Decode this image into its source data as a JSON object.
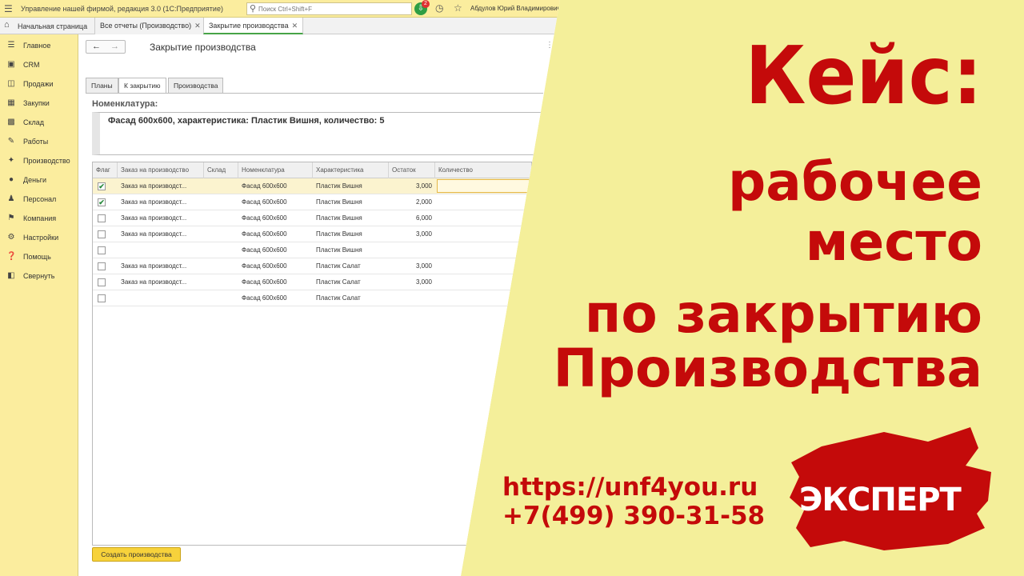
{
  "app": {
    "title": "Управление нашей фирмой, редакция 3.0  (1С:Предприятие)",
    "search_placeholder": "Поиск Ctrl+Shift+F",
    "notification_count": "2",
    "user": "Абдулов Юрий Владимирович"
  },
  "tabs": {
    "home": "Начальная страница",
    "open": [
      {
        "label": "Все отчеты (Производство)"
      },
      {
        "label": "Закрытие производства"
      }
    ]
  },
  "sidebar": {
    "items": [
      {
        "label": "Главное",
        "icon": "list-icon"
      },
      {
        "label": "CRM",
        "icon": "crm-icon"
      },
      {
        "label": "Продажи",
        "icon": "cart-icon"
      },
      {
        "label": "Закупки",
        "icon": "purchase-icon"
      },
      {
        "label": "Склад",
        "icon": "warehouse-icon"
      },
      {
        "label": "Работы",
        "icon": "works-icon"
      },
      {
        "label": "Производство",
        "icon": "tools-icon"
      },
      {
        "label": "Деньги",
        "icon": "money-icon"
      },
      {
        "label": "Персонал",
        "icon": "people-icon"
      },
      {
        "label": "Компания",
        "icon": "flag-icon"
      },
      {
        "label": "Настройки",
        "icon": "gear-icon"
      },
      {
        "label": "Помощь",
        "icon": "help-icon"
      },
      {
        "label": "Свернуть",
        "icon": "collapse-icon"
      }
    ]
  },
  "form": {
    "title": "Закрытие производства",
    "tabs": [
      {
        "label": "Планы"
      },
      {
        "label": "К закрытию"
      },
      {
        "label": "Производства"
      }
    ],
    "nomenclature_label": "Номенклатура:",
    "nomenclature_value": "Фасад 600х600, характеристика: Пластик Вишня, количество: 5",
    "columns": [
      "Флаг",
      "Заказ на производство",
      "Склад",
      "Номенклатура",
      "Характеристика",
      "Остаток",
      "Количество"
    ],
    "rows": [
      {
        "flag": true,
        "order": "Заказ на производст...",
        "warehouse": "",
        "item": "Фасад 600х600",
        "characteristic": "Пластик Вишня",
        "balance": "3,000",
        "quantity": ""
      },
      {
        "flag": true,
        "order": "Заказ на производст...",
        "warehouse": "",
        "item": "Фасад 600х600",
        "characteristic": "Пластик Вишня",
        "balance": "2,000",
        "quantity": ""
      },
      {
        "flag": false,
        "order": "Заказ на производст...",
        "warehouse": "",
        "item": "Фасад 600х600",
        "characteristic": "Пластик Вишня",
        "balance": "6,000",
        "quantity": ""
      },
      {
        "flag": false,
        "order": "Заказ на производст...",
        "warehouse": "",
        "item": "Фасад 600х600",
        "characteristic": "Пластик Вишня",
        "balance": "3,000",
        "quantity": ""
      },
      {
        "flag": false,
        "order": "",
        "warehouse": "",
        "item": "Фасад 600х600",
        "characteristic": "Пластик Вишня",
        "balance": "",
        "quantity": ""
      },
      {
        "flag": false,
        "order": "Заказ на производст...",
        "warehouse": "",
        "item": "Фасад 600х600",
        "characteristic": "Пластик Салат",
        "balance": "3,000",
        "quantity": ""
      },
      {
        "flag": false,
        "order": "Заказ на производст...",
        "warehouse": "",
        "item": "Фасад 600х600",
        "characteristic": "Пластик Салат",
        "balance": "3,000",
        "quantity": ""
      },
      {
        "flag": false,
        "order": "",
        "warehouse": "",
        "item": "Фасад 600х600",
        "characteristic": "Пластик Салат",
        "balance": "",
        "quantity": ""
      }
    ],
    "create_button": "Создать производства"
  },
  "promo": {
    "headline": "Кейс:",
    "lines": [
      "рабочее",
      "место",
      "по закрытию",
      "Производства"
    ],
    "url": "https://unf4you.ru",
    "phone": "+7(499) 390-31-58",
    "badge": "ЭКСПЕРТ",
    "accent_color": "#c40a0a",
    "background_color": "#f4ef9a"
  }
}
